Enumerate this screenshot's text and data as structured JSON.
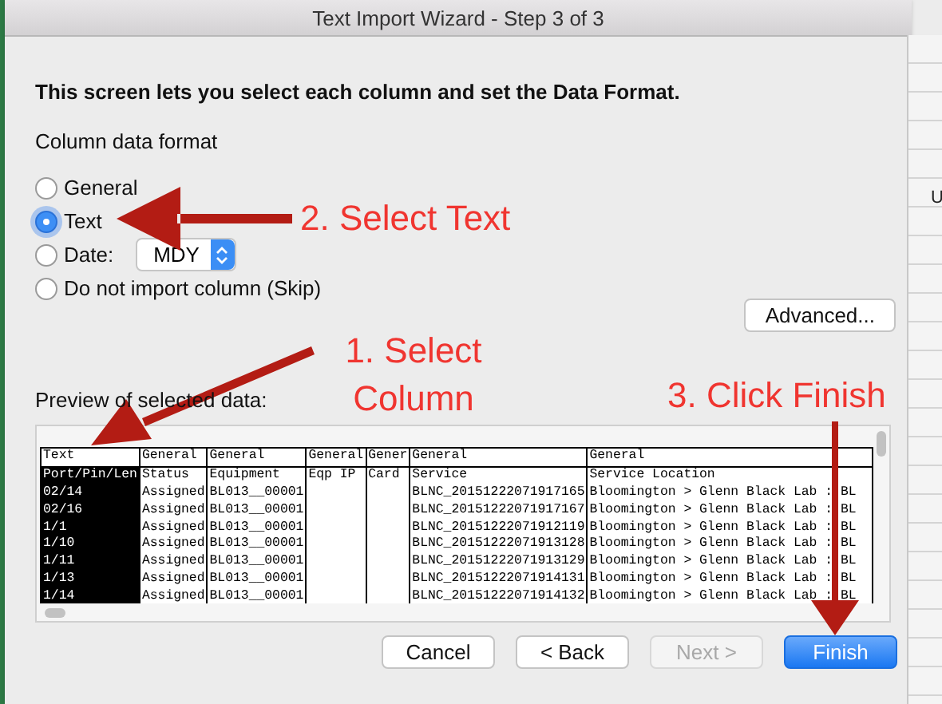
{
  "window": {
    "title": "Text Import Wizard - Step 3 of 3"
  },
  "instruction": "This screen lets you select each column and set the Data Format.",
  "format_group": {
    "label": "Column data format",
    "date_format": "MDY",
    "options": [
      {
        "label": "General",
        "selected": false,
        "kind": "plain"
      },
      {
        "label": "Text",
        "selected": true,
        "kind": "plain"
      },
      {
        "label": "Date:",
        "selected": false,
        "kind": "date"
      },
      {
        "label": "Do not import column (Skip)",
        "selected": false,
        "kind": "plain"
      }
    ]
  },
  "advanced_button": "Advanced...",
  "preview": {
    "label": "Preview of selected data:",
    "columns": [
      {
        "format": "Text",
        "selected": true
      },
      {
        "format": "General",
        "selected": false
      },
      {
        "format": "General",
        "selected": false
      },
      {
        "format": "General",
        "selected": false
      },
      {
        "format": "Gener",
        "selected": false
      },
      {
        "format": "General",
        "selected": false
      },
      {
        "format": "General",
        "selected": false
      }
    ],
    "rows": [
      [
        "Port/Pin/Len",
        "Status",
        "Equipment",
        "Eqp IP",
        "Card",
        "Service",
        "Service Location"
      ],
      [
        "02/14",
        "Assigned",
        "BL013__00001",
        null,
        null,
        "BLNC_20151222071917165",
        "Bloomington > Glenn Black Lab : BL"
      ],
      [
        "02/16",
        "Assigned",
        "BL013__00001",
        null,
        null,
        "BLNC_20151222071917167",
        "Bloomington > Glenn Black Lab : BL"
      ],
      [
        "1/1",
        "Assigned",
        "BL013__00001",
        null,
        null,
        "BLNC_20151222071912119",
        "Bloomington > Glenn Black Lab : BL"
      ],
      [
        "1/10",
        "Assigned",
        "BL013__00001",
        null,
        null,
        "BLNC_20151222071913128",
        "Bloomington > Glenn Black Lab : BL"
      ],
      [
        "1/11",
        "Assigned",
        "BL013__00001",
        null,
        null,
        "BLNC_20151222071913129",
        "Bloomington > Glenn Black Lab : BL"
      ],
      [
        "1/13",
        "Assigned",
        "BL013__00001",
        null,
        null,
        "BLNC_20151222071914131",
        "Bloomington > Glenn Black Lab : BL"
      ],
      [
        "1/14",
        "Assigned",
        "BL013__00001",
        null,
        null,
        "BLNC_20151222071914132",
        "Bloomington > Glenn Black Lab : BL"
      ]
    ]
  },
  "buttons": [
    {
      "label": "Cancel",
      "kind": "normal",
      "disabled": false
    },
    {
      "label": "< Back",
      "kind": "normal",
      "disabled": false
    },
    {
      "label": "Next >",
      "kind": "normal",
      "disabled": true
    },
    {
      "label": "Finish",
      "kind": "default",
      "disabled": false
    }
  ],
  "annotations": [
    {
      "text": "2. Select Text",
      "kind": "text-step"
    },
    {
      "text": "1. Select Column",
      "kind": "column-step"
    },
    {
      "text": "3. Click Finish",
      "kind": "finish-step"
    }
  ],
  "background_text": "U"
}
